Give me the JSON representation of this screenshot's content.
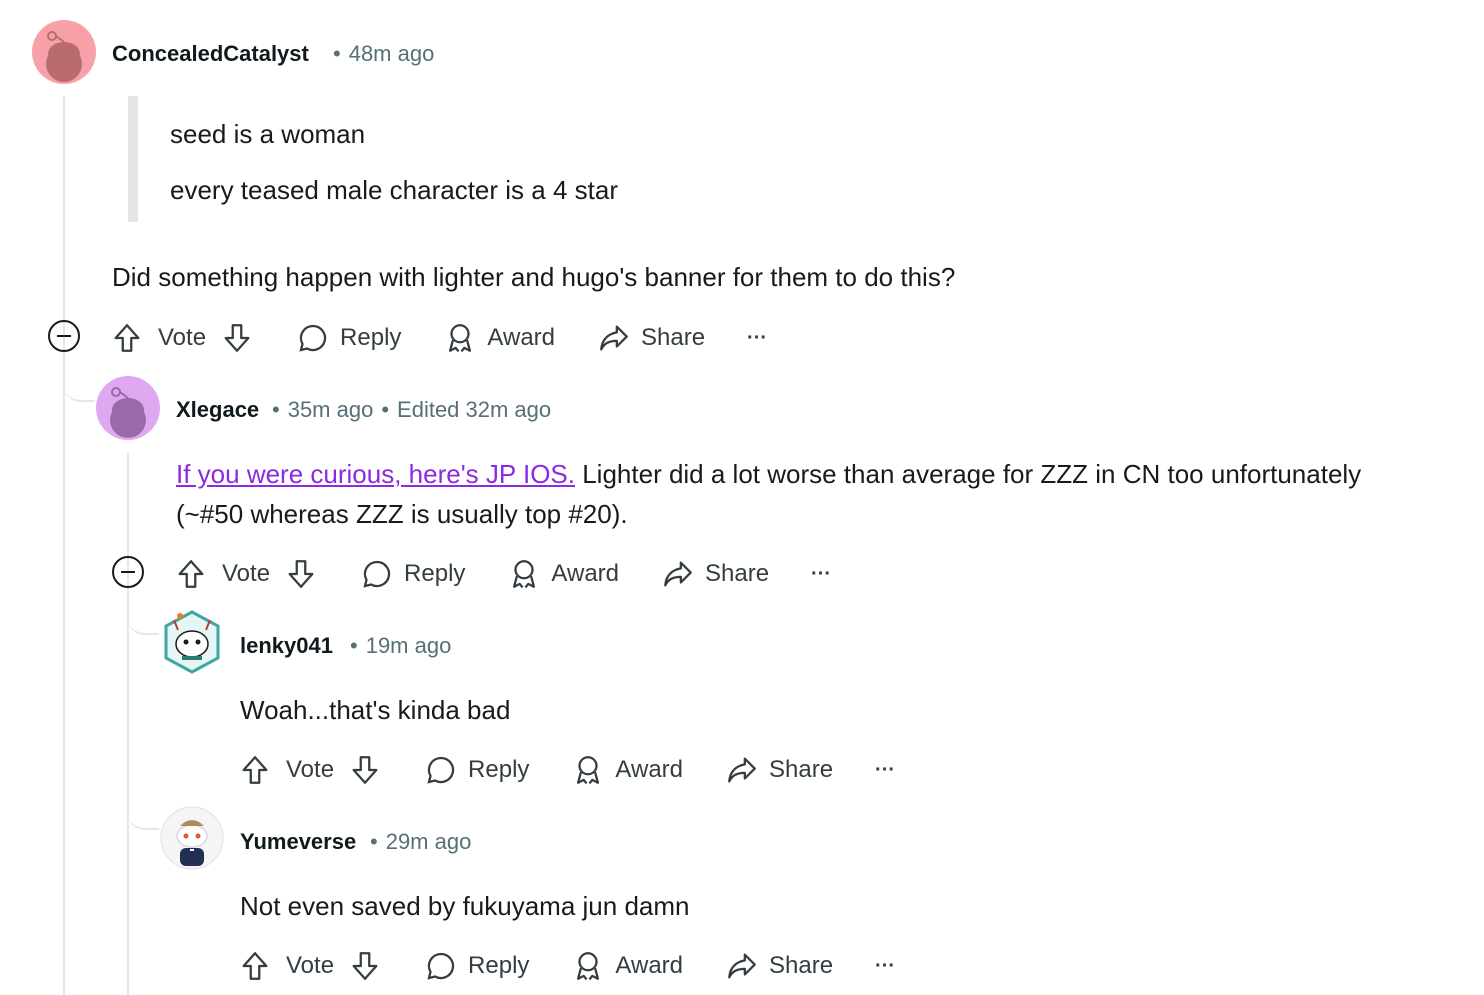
{
  "comments": [
    {
      "username": "ConcealedCatalyst",
      "time": "48m ago",
      "quote": [
        "seed is a woman",
        "every teased male character is a 4 star"
      ],
      "text": "Did something happen with lighter and hugo's banner for them to do this?",
      "avatar_color": "#f7a0a8"
    },
    {
      "username": "Xlegace",
      "time": "35m ago",
      "edited": "Edited 32m ago",
      "link_text": "If you were curious, here's JP IOS.",
      "text_after_link": " Lighter did a lot worse than average for ZZZ in CN too unfortunately",
      "text_line2": "(~#50 whereas ZZZ is usually top #20).",
      "avatar_color": "#e0a8f0"
    },
    {
      "username": "lenky041",
      "time": "19m ago",
      "text": "Woah...that's kinda bad"
    },
    {
      "username": "Yumeverse",
      "time": "29m ago",
      "text": "Not even saved by fukuyama jun damn"
    }
  ],
  "actions": {
    "vote": "Vote",
    "reply": "Reply",
    "award": "Award",
    "share": "Share",
    "more": "···"
  },
  "colors": {
    "link": "#8a2be2",
    "meta": "#576f76",
    "thread_line": "#e2e7e9"
  }
}
